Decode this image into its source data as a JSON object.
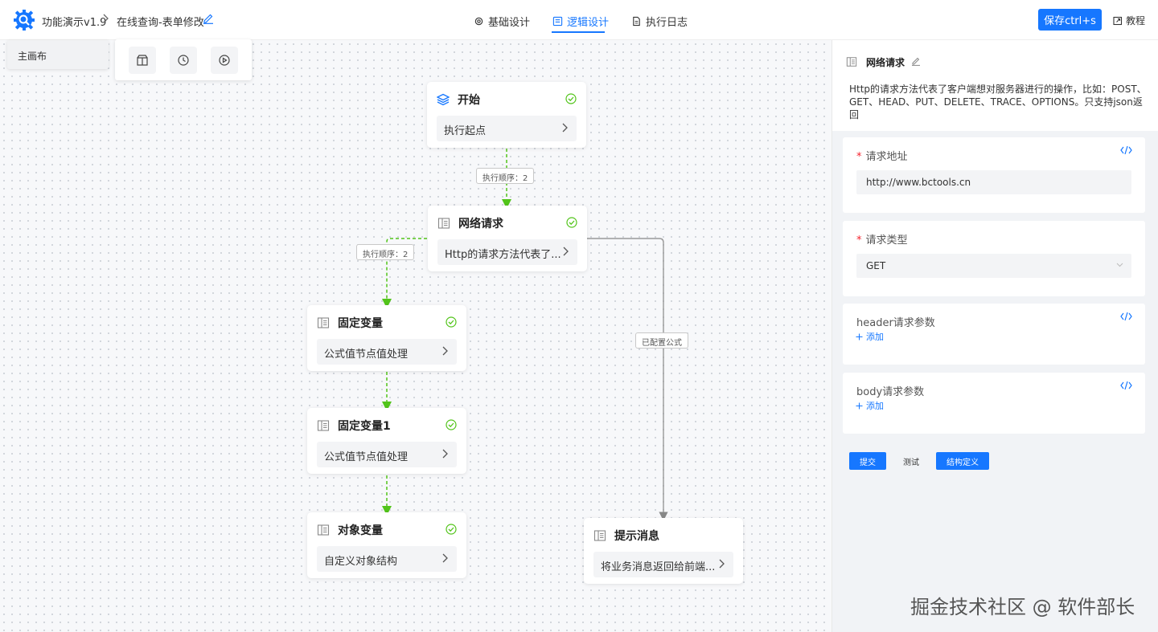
{
  "header": {
    "app_name": "功能演示v1.9",
    "breadcrumb_sep": ">",
    "page_name": "在线查询-表单修改",
    "tabs": [
      {
        "label": "基础设计",
        "icon": "gear-icon",
        "active": false
      },
      {
        "label": "逻辑设计",
        "icon": "logic-icon",
        "active": true
      },
      {
        "label": "执行日志",
        "icon": "file-icon",
        "active": false
      }
    ],
    "save_label": "保存ctrl+s",
    "tutorial_label": "教程",
    "accent_color": "#1677ff"
  },
  "canvas": {
    "canvas_tab": "主画布",
    "toolbar": [
      "package-icon",
      "clock-icon",
      "play-icon"
    ]
  },
  "nodes": [
    {
      "title": "开始",
      "body": "执行起点",
      "icon": "layers-icon",
      "status": "ok"
    },
    {
      "title": "网络请求",
      "body": "Http的请求方法代表了...",
      "icon": "doc-icon",
      "status": "ok"
    },
    {
      "title": "固定变量",
      "body": "公式值节点值处理",
      "icon": "doc-icon",
      "status": "ok"
    },
    {
      "title": "固定变量1",
      "body": "公式值节点值处理",
      "icon": "doc-icon",
      "status": "ok"
    },
    {
      "title": "对象变量",
      "body": "自定义对象结构",
      "icon": "doc-icon",
      "status": "ok"
    },
    {
      "title": "提示消息",
      "body": "将业务消息返回给前端...",
      "icon": "doc-icon",
      "status": ""
    }
  ],
  "edge_labels": [
    "执行顺序：2",
    "执行顺序：2",
    "已配置公式"
  ],
  "panel": {
    "title": "网络请求",
    "description": "Http的请求方法代表了客户端想对服务器进行的操作，比如：POST、GET、HEAD、PUT、DELETE、TRACE、OPTIONS。只支持json返回",
    "url": {
      "label": "请求地址",
      "required": "*",
      "value": "http://www.bctools.cn"
    },
    "method": {
      "label": "请求类型",
      "required": "*",
      "value": "GET"
    },
    "header_params": {
      "label": "header请求参数",
      "add": "添加"
    },
    "body_params": {
      "label": "body请求参数",
      "add": "添加"
    },
    "buttons": {
      "submit": "提交",
      "test": "测试",
      "schema": "结构定义"
    }
  },
  "watermark": "掘金技术社区 @ 软件部长"
}
